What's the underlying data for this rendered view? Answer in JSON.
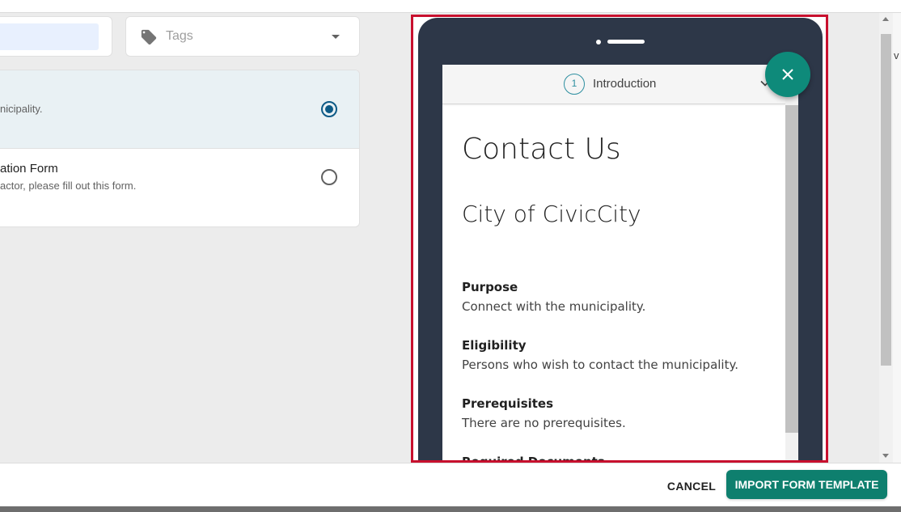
{
  "filters": {
    "search_value": "",
    "tags_placeholder": "Tags"
  },
  "templates": [
    {
      "title": "",
      "description": "nicipality.",
      "selected": true
    },
    {
      "title": "ation Form",
      "description": "actor, please fill out this form.",
      "selected": false
    }
  ],
  "preview": {
    "step_number": "1",
    "step_label": "Introduction",
    "heading": "Contact Us",
    "subheading": "City of CivicCity",
    "sections": [
      {
        "title": "Purpose",
        "body": "Connect with the municipality."
      },
      {
        "title": "Eligibility",
        "body": "Persons who wish to contact the municipality."
      },
      {
        "title": "Prerequisites",
        "body": "There are no prerequisites."
      },
      {
        "title": "Required Documents",
        "body": ""
      }
    ]
  },
  "edge_text": "v",
  "footer": {
    "cancel_label": "CANCEL",
    "import_label": "IMPORT FORM TEMPLATE"
  },
  "colors": {
    "accent": "#0e7f6e",
    "fab": "#0e8a7a",
    "highlight_border": "#c8102e",
    "device": "#2d3748",
    "selected_row": "#e9f1f4",
    "radio_selected": "#0d5a86"
  }
}
